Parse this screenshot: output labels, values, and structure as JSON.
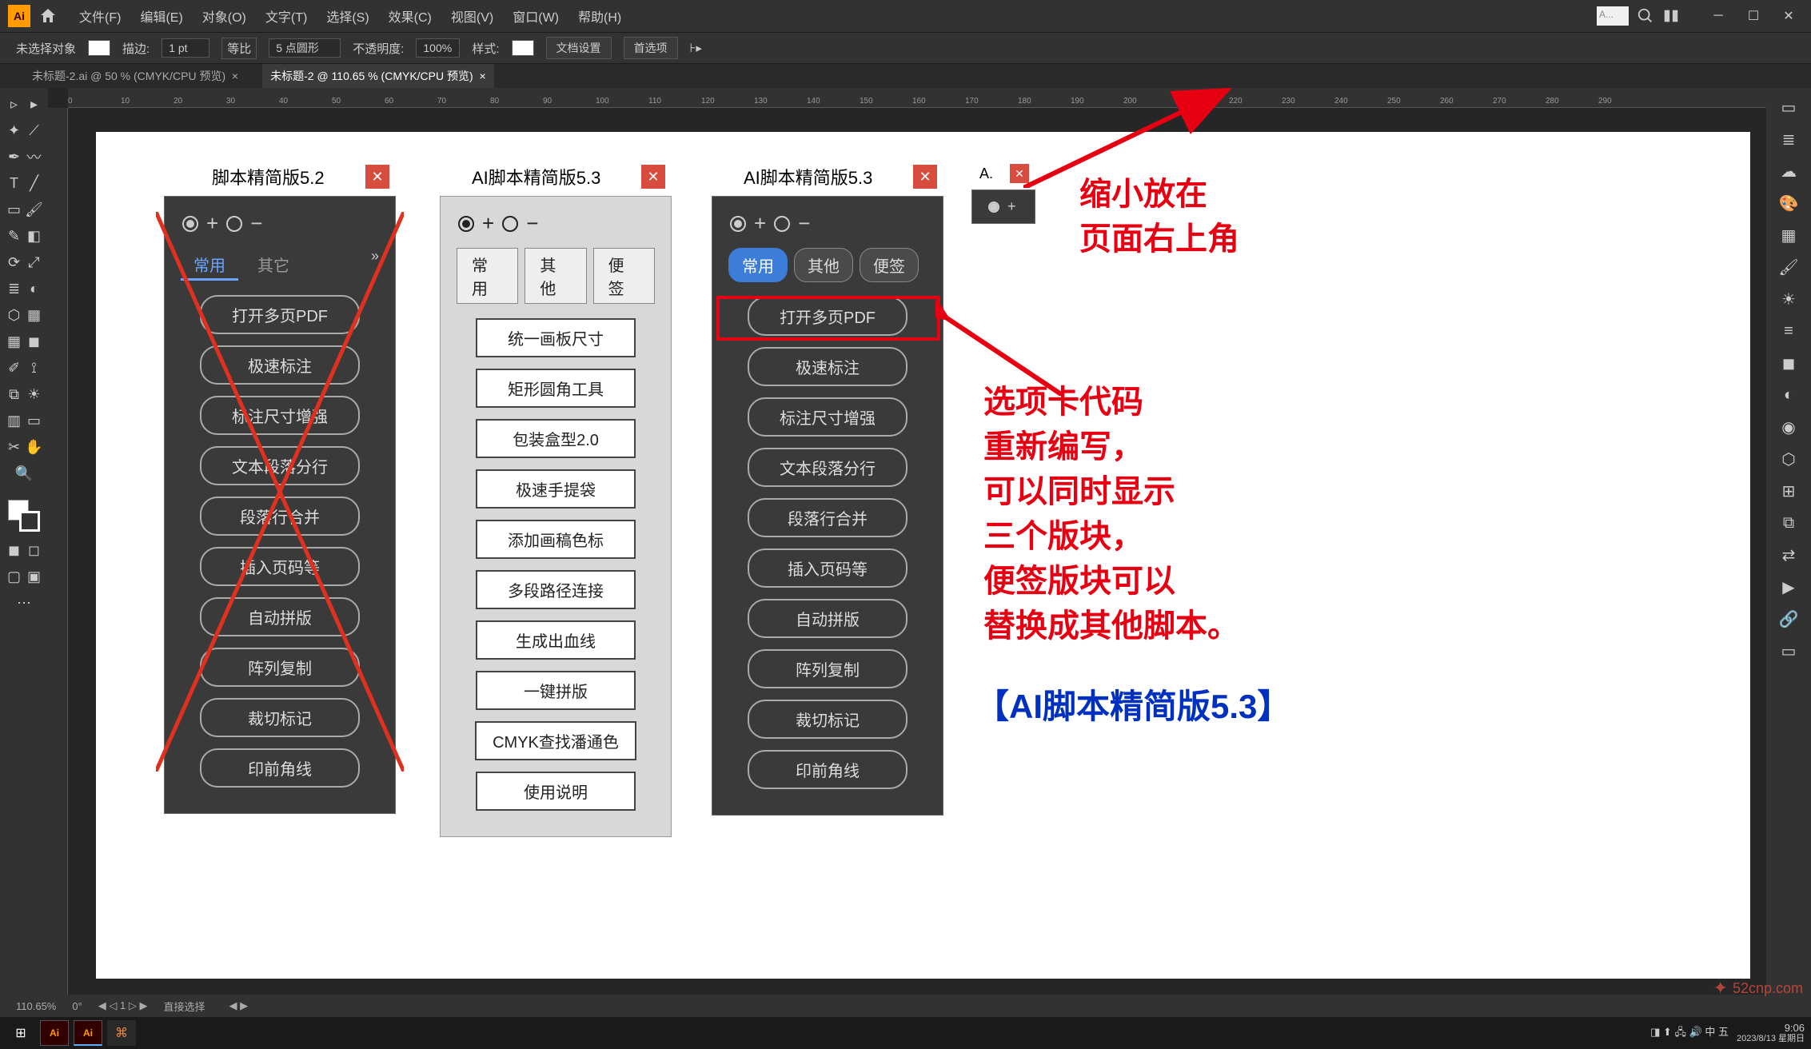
{
  "menu": {
    "items": [
      "文件(F)",
      "编辑(E)",
      "对象(O)",
      "文字(T)",
      "选择(S)",
      "效果(C)",
      "视图(V)",
      "窗口(W)",
      "帮助(H)"
    ],
    "search_placeholder": "A..."
  },
  "controlbar": {
    "no_selection": "未选择对象",
    "stroke_label": "描边:",
    "stroke_value": "1 pt",
    "uniform": "等比",
    "brush_value": "5 点圆形",
    "opacity_label": "不透明度:",
    "opacity_value": "100%",
    "style_label": "样式:",
    "doc_setup": "文档设置",
    "prefs": "首选项"
  },
  "tabs": [
    "未标题-2.ai @ 50 % (CMYK/CPU 预览)",
    "未标题-2 @ 110.65 % (CMYK/CPU 预览)"
  ],
  "active_tab_index": 1,
  "ruler_ticks": [
    "0",
    "10",
    "20",
    "30",
    "40",
    "50",
    "60",
    "70",
    "80",
    "90",
    "100",
    "110",
    "120",
    "130",
    "140",
    "150",
    "160",
    "170",
    "180",
    "190",
    "200",
    "210",
    "220",
    "230",
    "240",
    "250",
    "260",
    "270",
    "280",
    "290"
  ],
  "panel52": {
    "title": "脚本精简版5.2",
    "tabs": [
      "常用",
      "其它"
    ],
    "buttons": [
      "打开多页PDF",
      "极速标注",
      "标注尺寸增强",
      "文本段落分行",
      "段落行合并",
      "插入页码等",
      "自动拼版",
      "阵列复制",
      "裁切标记",
      "印前角线"
    ]
  },
  "panel53_light": {
    "title": "AI脚本精简版5.3",
    "tabs": [
      "常用",
      "其他",
      "便签"
    ],
    "buttons": [
      "统一画板尺寸",
      "矩形圆角工具",
      "包装盒型2.0",
      "极速手提袋",
      "添加画稿色标",
      "多段路径连接",
      "生成出血线",
      "一键拼版",
      "CMYK查找潘通色",
      "使用说明"
    ]
  },
  "panel53_dark": {
    "title": "AI脚本精简版5.3",
    "tabs": [
      "常用",
      "其他",
      "便签"
    ],
    "buttons": [
      "打开多页PDF",
      "极速标注",
      "标注尺寸增强",
      "文本段落分行",
      "段落行合并",
      "插入页码等",
      "自动拼版",
      "阵列复制",
      "裁切标记",
      "印前角线"
    ]
  },
  "panel_mini": {
    "title": "A."
  },
  "annotations": {
    "top_line1": "缩小放在",
    "top_line2": "页面右上角",
    "body_line1": "选项卡代码",
    "body_line2": "重新编写，",
    "body_line3": "可以同时显示",
    "body_line4": "三个版块，",
    "body_line5": "便签版块可以",
    "body_line6": "替换成其他脚本。",
    "footer": "【AI脚本精简版5.3】"
  },
  "status": {
    "zoom": "110.65%",
    "rotation": "0°",
    "artboard": "1",
    "tool": "直接选择"
  },
  "taskbar": {
    "time": "9:06",
    "date": "2023/8/13 星期日",
    "ime": "五",
    "lang": "中"
  },
  "watermark": "52cnp.com"
}
